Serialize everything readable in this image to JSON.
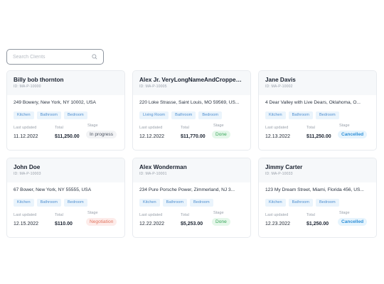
{
  "search": {
    "placeholder": "Search Clients"
  },
  "labels": {
    "last_updated": "Last updated",
    "total": "Total",
    "stage": "Stage"
  },
  "cards": [
    {
      "name": "Billy bob thornton",
      "id": "ID: MA-P-10000",
      "address": "249 Bowery, New York, NY 10002, USA",
      "tags": [
        "Kitchen",
        "Bathroom",
        "Bedroom"
      ],
      "last_updated": "11.12.2022",
      "total": "$11,250.00",
      "stage": "In progress",
      "stage_kind": "progress"
    },
    {
      "name": "Alex Jr. VeryLongNameAndCroppedF...",
      "id": "ID: MA-P-10005",
      "address": "220 Loke Strasse, Saint Louis, MO 59569, US...",
      "tags": [
        "Living Room",
        "Bathroom",
        "Bedroom"
      ],
      "last_updated": "12.12.2022",
      "total": "$11,770.00",
      "stage": "Done",
      "stage_kind": "done"
    },
    {
      "name": "Jane Davis",
      "id": "ID: MA-P-10002",
      "address": "4 Dear Valley with Live Dears, Oklahoma, O...",
      "tags": [
        "Kitchen",
        "Bathroom",
        "Bedroom"
      ],
      "last_updated": "12.13.2022",
      "total": "$11,250.00",
      "stage": "Cancelled",
      "stage_kind": "cancelled"
    },
    {
      "name": "John Doe",
      "id": "ID: MA-P-10003",
      "address": "67 Bower, New York, NY 55555, USA",
      "tags": [
        "Kitchen",
        "Bathroom",
        "Bedroom"
      ],
      "last_updated": "12.15.2022",
      "total": "$110.00",
      "stage": "Negotiation",
      "stage_kind": "negotiation"
    },
    {
      "name": "Alex Wonderman",
      "id": "ID: MA-P-10001",
      "address": "234 Pure Porsche Power, Zimmerland, NJ 3...",
      "tags": [
        "Kitchen",
        "Bathroom",
        "Bedroom"
      ],
      "last_updated": "12.22.2022",
      "total": "$5,253.00",
      "stage": "Done",
      "stage_kind": "done"
    },
    {
      "name": "Jimmy Carter",
      "id": "ID: MA-P-10033",
      "address": "123 My Dream Street, Miami, Florida 456, US...",
      "tags": [
        "Kitchen",
        "Bathroom",
        "Bedroom"
      ],
      "last_updated": "12.23.2022",
      "total": "$1,250.00",
      "stage": "Cancelled",
      "stage_kind": "cancelled"
    }
  ],
  "colors": {
    "tag_text": "#4f8fd0",
    "tag_bg": "#eaf4fc",
    "done": "#3aa65a",
    "cancelled": "#2f90d8",
    "negotiation": "#e2755f"
  },
  "icons": {
    "search": "search-icon"
  }
}
